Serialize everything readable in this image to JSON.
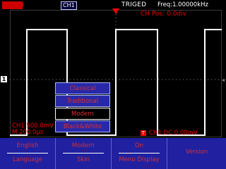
{
  "topbar": {
    "channel_badge": "CH1",
    "trigger_status": "TRIGED",
    "frequency": "Freq:1.00000kHz"
  },
  "channel_position": "CH Pos: 0.0div",
  "channel_marker": "1",
  "channel_scale": {
    "volts": "CH1 500.0mV",
    "timebase": "M 200.0μs"
  },
  "trigger_level": {
    "box": "T",
    "text": "CH1 DC 0.00mV"
  },
  "popup_menu": {
    "items": [
      "Classical",
      "Traditional",
      "Modern",
      "Black&White"
    ],
    "selected": "Modern"
  },
  "softkeys": [
    {
      "top": "English",
      "bottom": "Language"
    },
    {
      "top": "Modern",
      "bottom": "Skin"
    },
    {
      "top": "On",
      "bottom": "Menu Display"
    },
    {
      "single": "Version"
    }
  ],
  "colors": {
    "accent_red": "#e00000",
    "menu_blue": "#2020a0",
    "trace": "#ffffff"
  }
}
